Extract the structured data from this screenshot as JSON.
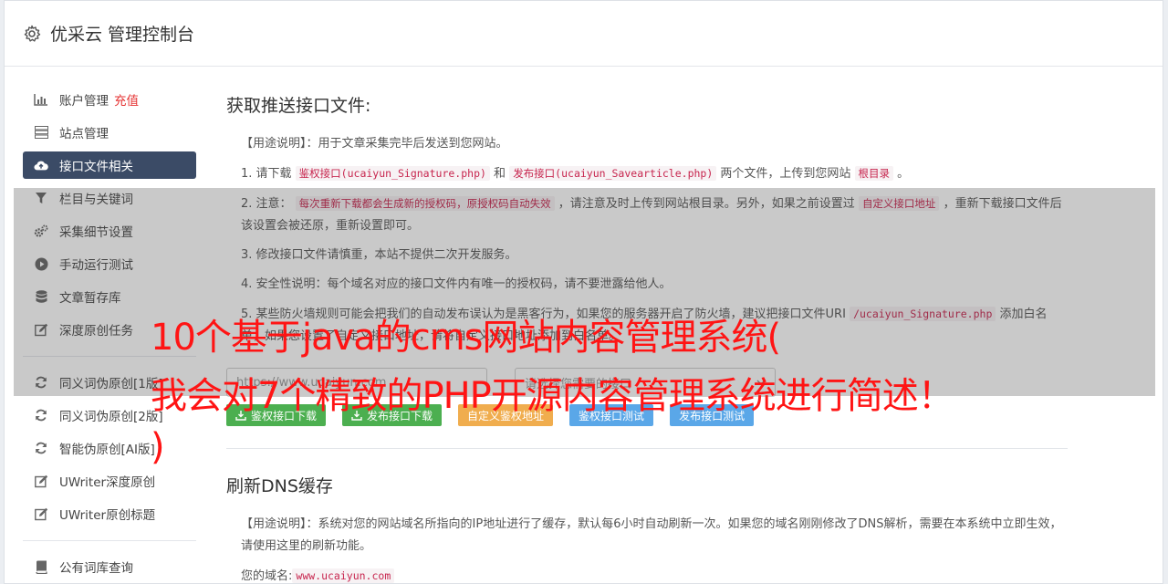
{
  "header": {
    "title": "优采云 管理控制台",
    "icon": "gear-icon"
  },
  "sidebar": {
    "items": [
      {
        "label": "账户管理",
        "extra": "充值",
        "icon": "bar-chart-icon"
      },
      {
        "label": "站点管理",
        "icon": "server-icon"
      },
      {
        "label": "接口文件相关",
        "icon": "cloud-upload-icon",
        "active": true
      },
      {
        "label": "栏目与关键词",
        "icon": "filter-icon"
      },
      {
        "label": "采集细节设置",
        "icon": "cogs-icon"
      },
      {
        "label": "手动运行测试",
        "icon": "play-circle-icon"
      },
      {
        "label": "文章暂存库",
        "icon": "database-icon"
      },
      {
        "label": "深度原创任务",
        "icon": "edit-icon"
      }
    ],
    "items2": [
      {
        "label": "同义词伪原创[1版]",
        "icon": "refresh-icon"
      },
      {
        "label": "同义词伪原创[2版]",
        "icon": "refresh-icon"
      },
      {
        "label": "智能伪原创[AI版]",
        "icon": "refresh-icon"
      },
      {
        "label": "UWriter深度原创",
        "icon": "edit-icon"
      },
      {
        "label": "UWriter原创标题",
        "icon": "edit-icon"
      }
    ],
    "items3": [
      {
        "label": "公有词库查询",
        "icon": "book-icon"
      }
    ]
  },
  "section1": {
    "title": "获取推送接口文件:",
    "usage_prefix": "【用途说明】：",
    "usage_text": "用于文章采集完毕后发送到您网站。",
    "p1": {
      "a": "1. 请下载 ",
      "code1": "鉴权接口(ucaiyun_Signature.php)",
      "b": " 和 ",
      "code2": "发布接口(ucaiyun_Savearticle.php)",
      "c": " 两个文件，上传到您网站 ",
      "code3": "根目录",
      "d": " 。"
    },
    "p2": {
      "a": "2. 注意： ",
      "code1": "每次重新下载都会生成新的授权码，原授权码自动失效",
      "b": " ，请注意及时上传到网站根目录。另外，如果之前设置过 ",
      "code2": "自定义接口地址",
      "c": " ，重新下载接口文件后该设置会被还原，重新设置即可。"
    },
    "p3": "3. 修改接口文件请慎重，本站不提供二次开发服务。",
    "p4": "4. 安全性说明：每个域名对应的接口文件内有唯一的授权码，请不要泄露给他人。",
    "p5": {
      "a": "5. 某些防火墙规则可能会把我们的自动发布误认为是黑客行为，如果您的服务器开启了防火墙，建议把接口文件URI ",
      "code1": "/ucaiyun_Signature.php",
      "b": " 添加白名单，如果您设置了自定义接口地址，请将自定义接口地址添加到白名单。"
    },
    "url_placeholder": "https://www.ucaiyun.com",
    "select_placeholder": "请选择您需要的接口",
    "buttons": {
      "download_sign": "鉴权接口下载",
      "download_publish": "发布接口下载",
      "custom_sign": "自定义鉴权地址",
      "test_sign": "鉴权接口测试",
      "test_publish": "发布接口测试"
    }
  },
  "section2": {
    "title": "刷新DNS缓存",
    "usage_prefix": "【用途说明】：",
    "usage_text": "系统对您的网站域名所指向的IP地址进行了缓存，默认每6小时自动刷新一次。如果您的域名刚刚修改了DNS解析，需要在本系统中立即生效，请使用这里的刷新功能。",
    "domain_label": "您的域名:",
    "domain_value": "www.ucaiyun.com"
  },
  "caption": {
    "line1": "10个基于java的cms网站内容管理系统(",
    "line2": "我会对7个精致的PHP开源内容管理系统进行简述！",
    "line3": ")"
  },
  "colors": {
    "active_nav": "#3b4b66",
    "caption": "#ff1414",
    "code": "#c7254e",
    "green": "#4caf50",
    "orange": "#f0ad4e",
    "blue": "#5aa7e8"
  }
}
